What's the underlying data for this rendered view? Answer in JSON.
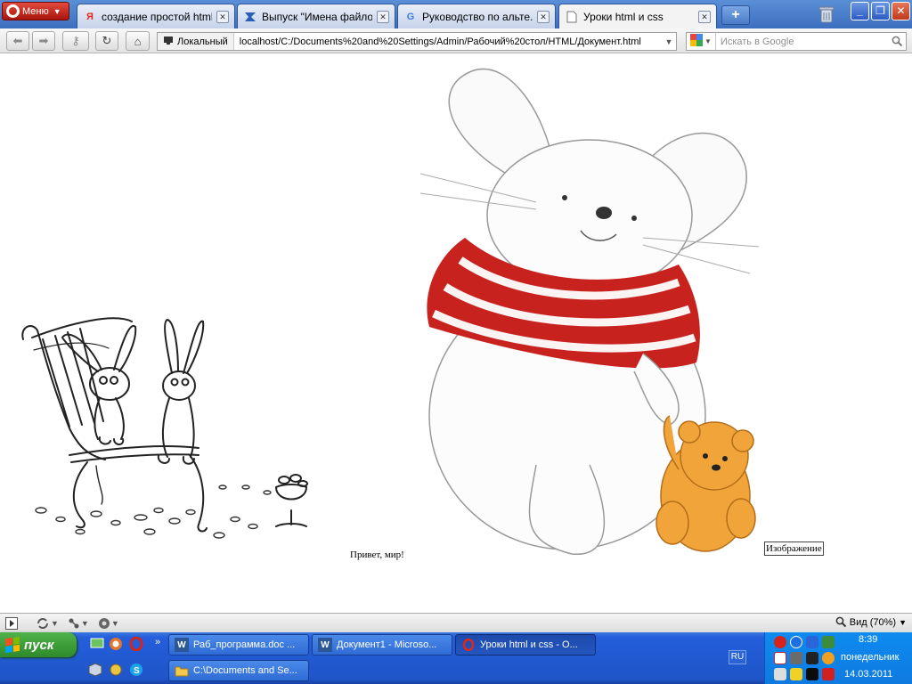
{
  "browser": {
    "menu_label": "Меню",
    "tabs": [
      {
        "title": "создание простой html-...",
        "favicon": "yandex-icon",
        "favicon_text": "Я"
      },
      {
        "title": "Выпуск \"Имена файлов ...",
        "favicon": "feed-icon",
        "favicon_text": ""
      },
      {
        "title": "Руководство по альте...",
        "favicon": "google-icon",
        "favicon_text": "G"
      },
      {
        "title": "Уроки html и css",
        "favicon": "page-icon",
        "favicon_text": ""
      }
    ],
    "address": {
      "location_label": "Локальный",
      "url": "localhost/C:/Documents%20and%20Settings/Admin/Рабочий%20стол/HTML/Документ.html"
    },
    "search": {
      "placeholder": "Искать в Google"
    }
  },
  "page": {
    "hello_text": "Привет, мир!",
    "image_alt_text": "Изображение"
  },
  "status_bar": {
    "zoom_label": "Вид (70%)"
  },
  "taskbar": {
    "start_label": "пуск",
    "tasks_row1": [
      {
        "label": "Раб_программа.doc ...",
        "icon": "word-icon"
      },
      {
        "label": "Документ1 - Microso...",
        "icon": "word-icon"
      },
      {
        "label": "Уроки html и css - O...",
        "icon": "opera-icon"
      }
    ],
    "tasks_row2": [
      {
        "label": "C:\\Documents and Se...",
        "icon": "folder-icon"
      }
    ],
    "language": "RU",
    "clock": {
      "time": "8:39",
      "day": "понедельник",
      "date": "14.03.2011"
    }
  },
  "colors": {
    "taskbar_blue": "#245edb",
    "start_green": "#3c9a37",
    "opera_red": "#cc1b10",
    "tray_blue": "#0f7ae0"
  }
}
